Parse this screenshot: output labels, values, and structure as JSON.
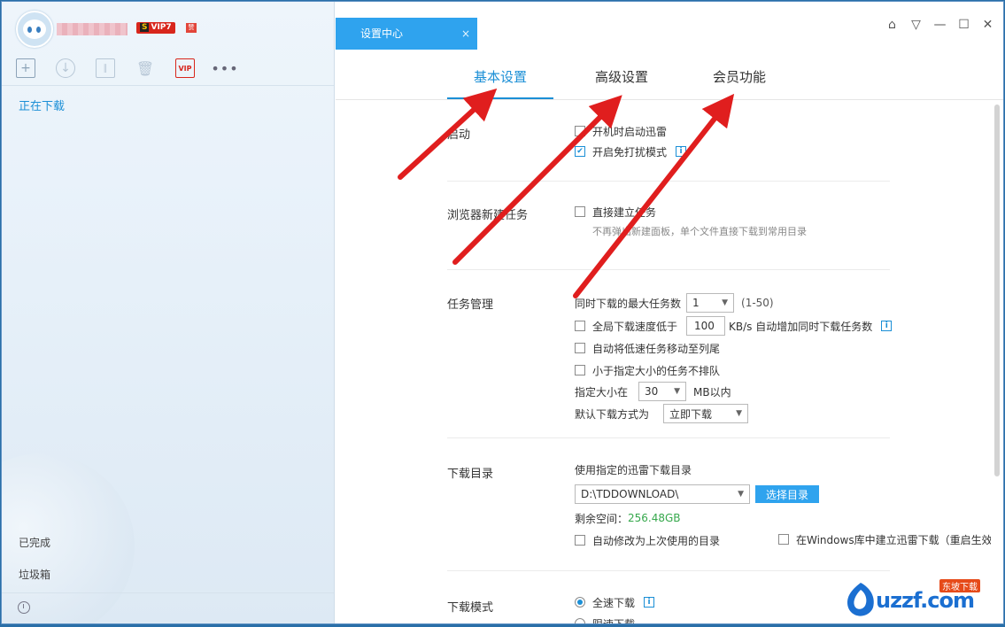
{
  "colors": {
    "accent": "#2fa3ee",
    "active_tab": "#1b8fd6",
    "arrow": "#e01e1e",
    "success": "#36a84c"
  },
  "left_panel": {
    "vip_level": "VIP7",
    "vip_s": "S",
    "badge": "赞",
    "toolbar": {
      "icons": [
        "new-task-icon",
        "download-icon",
        "pause-icon",
        "trash-icon",
        "vip-icon",
        "more-icon"
      ],
      "vip_label": "VIP",
      "more_label": "•••"
    },
    "nav": {
      "downloading": "正在下载",
      "completed": "已完成",
      "trash": "垃圾箱"
    }
  },
  "panel_tab": {
    "title": "设置中心",
    "close": "×"
  },
  "window_controls": [
    "skin-icon",
    "menu-icon",
    "minimize-icon",
    "maximize-icon",
    "close-icon"
  ],
  "tabs": [
    {
      "label": "基本设置",
      "active": true
    },
    {
      "label": "高级设置",
      "active": false
    },
    {
      "label": "会员功能",
      "active": false
    }
  ],
  "sections": {
    "startup": {
      "label": "启动",
      "opt_boot": "开机时启动迅雷",
      "opt_nodisturb": "开启免打扰模式"
    },
    "browser": {
      "label": "浏览器新建任务",
      "opt_direct": "直接建立任务",
      "hint": "不再弹出新建面板，单个文件直接下载到常用目录"
    },
    "task": {
      "label": "任务管理",
      "max_tasks_label": "同时下载的最大任务数",
      "max_tasks_value": "1",
      "max_tasks_range": "(1-50)",
      "speed_prefix": "全局下载速度低于",
      "speed_value": "100",
      "speed_suffix": "KB/s 自动增加同时下载任务数",
      "opt_move_slow": "自动将低速任务移动至列尾",
      "opt_small_noqueue": "小于指定大小的任务不排队",
      "size_label": "指定大小在",
      "size_value": "30",
      "size_unit": "MB以内",
      "mode_label": "默认下载方式为",
      "mode_value": "立即下载"
    },
    "dir": {
      "label": "下载目录",
      "use_dir": "使用指定的迅雷下载目录",
      "path": "D:\\TDDOWNLOAD\\",
      "choose_btn": "选择目录",
      "free_label": "剩余空间：",
      "free_value": "256.48GB",
      "opt_auto_last": "自动修改为上次使用的目录",
      "opt_win_lib": "在Windows库中建立迅雷下载（重启生效）"
    },
    "mode": {
      "label": "下载模式",
      "opt_full": "全速下载",
      "opt_limit": "限速下载"
    }
  },
  "watermark": {
    "text": "uzzf.com",
    "sub": "东坡下载"
  }
}
